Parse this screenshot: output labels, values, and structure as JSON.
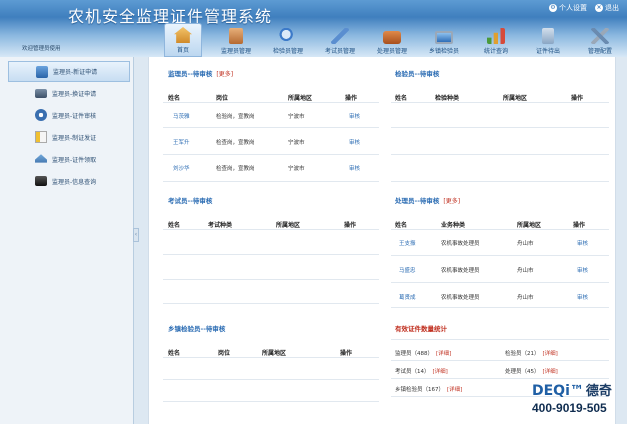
{
  "app": {
    "title": "农机安全监理证件管理系统",
    "welcome": "欢迎管理员使用",
    "settings": "个人设置",
    "logout": "退出"
  },
  "nav": [
    {
      "label": "首页",
      "icon": "home-icon",
      "color": "#e0a040"
    },
    {
      "label": "监理员管理",
      "icon": "clipboard-icon",
      "color": "#c07a3a"
    },
    {
      "label": "检验员管理",
      "icon": "magnifier-icon",
      "color": "#3c7ac9"
    },
    {
      "label": "考试员管理",
      "icon": "pen-icon",
      "color": "#5a8ed0"
    },
    {
      "label": "处理员管理",
      "icon": "briefcase-icon",
      "color": "#c06a30"
    },
    {
      "label": "乡镇检验员",
      "icon": "monitor-icon",
      "color": "#4b8fd6"
    },
    {
      "label": "统计查询",
      "icon": "bar-chart-icon",
      "color": "#d64a3a"
    },
    {
      "label": "证件待出",
      "icon": "card-icon",
      "color": "#8aa6c4"
    },
    {
      "label": "管理配置",
      "icon": "tools-icon",
      "color": "#6a8bb0"
    }
  ],
  "sidebar": [
    {
      "label": "监理员-新证申请",
      "icon": "user-card-icon"
    },
    {
      "label": "监理员-换证申请",
      "icon": "id-card-icon"
    },
    {
      "label": "监理员-证件审核",
      "icon": "fan-icon"
    },
    {
      "label": "监理员-制证发证",
      "icon": "document-icon"
    },
    {
      "label": "监理员-证件领取",
      "icon": "hat-icon"
    },
    {
      "label": "监理员-信息查询",
      "icon": "bag-icon"
    }
  ],
  "supervisor": {
    "title": "监理员--待审核",
    "more": "[更多]",
    "headers": [
      "姓名",
      "岗位",
      "所属地区",
      "操作"
    ],
    "rows": [
      {
        "name": "马茨雅",
        "post": "检验岗，宣教岗",
        "region": "宁波市",
        "action": "审核"
      },
      {
        "name": "王军升",
        "post": "检查岗，宣教岗",
        "region": "宁波市",
        "action": "审核"
      },
      {
        "name": "刘沙华",
        "post": "检查岗，宣教岗",
        "region": "宁波市",
        "action": "审核"
      }
    ]
  },
  "inspector": {
    "title": "检验员--待审核",
    "headers": [
      "姓名",
      "检验种类",
      "所属地区",
      "操作"
    ]
  },
  "examiner": {
    "title": "考试员--待审核",
    "headers": [
      "姓名",
      "考试种类",
      "所属地区",
      "操作"
    ]
  },
  "handler": {
    "title": "处理员--待审核",
    "more": "[更多]",
    "headers": [
      "姓名",
      "业务种类",
      "所属地区",
      "操作"
    ],
    "rows": [
      {
        "name": "王支振",
        "type": "农机事故处理员",
        "region": "舟山市",
        "action": "审核"
      },
      {
        "name": "马盛忠",
        "type": "农机事故处理员",
        "region": "舟山市",
        "action": "审核"
      },
      {
        "name": "葛贤成",
        "type": "农机事故处理员",
        "region": "舟山市",
        "action": "审核"
      }
    ]
  },
  "town": {
    "title": "乡镇检验员--待审核",
    "headers": [
      "姓名",
      "岗位",
      "所属地区",
      "操作"
    ]
  },
  "stats": {
    "title": "有效证件数量统计",
    "items": [
      {
        "label": "监理员（488）",
        "detail": "[详细]"
      },
      {
        "label": "检验员（21）",
        "detail": "[详细]"
      },
      {
        "label": "考试员（14）",
        "detail": "[详细]"
      },
      {
        "label": "处理员（45）",
        "detail": "[详细]"
      },
      {
        "label": "乡镇检验员（167）",
        "detail": "[详细]"
      }
    ]
  },
  "brand": {
    "logo_en": "DEQi™",
    "logo_zh": "德奇",
    "phone": "400-9019-505"
  },
  "colors": {
    "accent": "#2b6cb3",
    "link_red": "#c03020"
  }
}
